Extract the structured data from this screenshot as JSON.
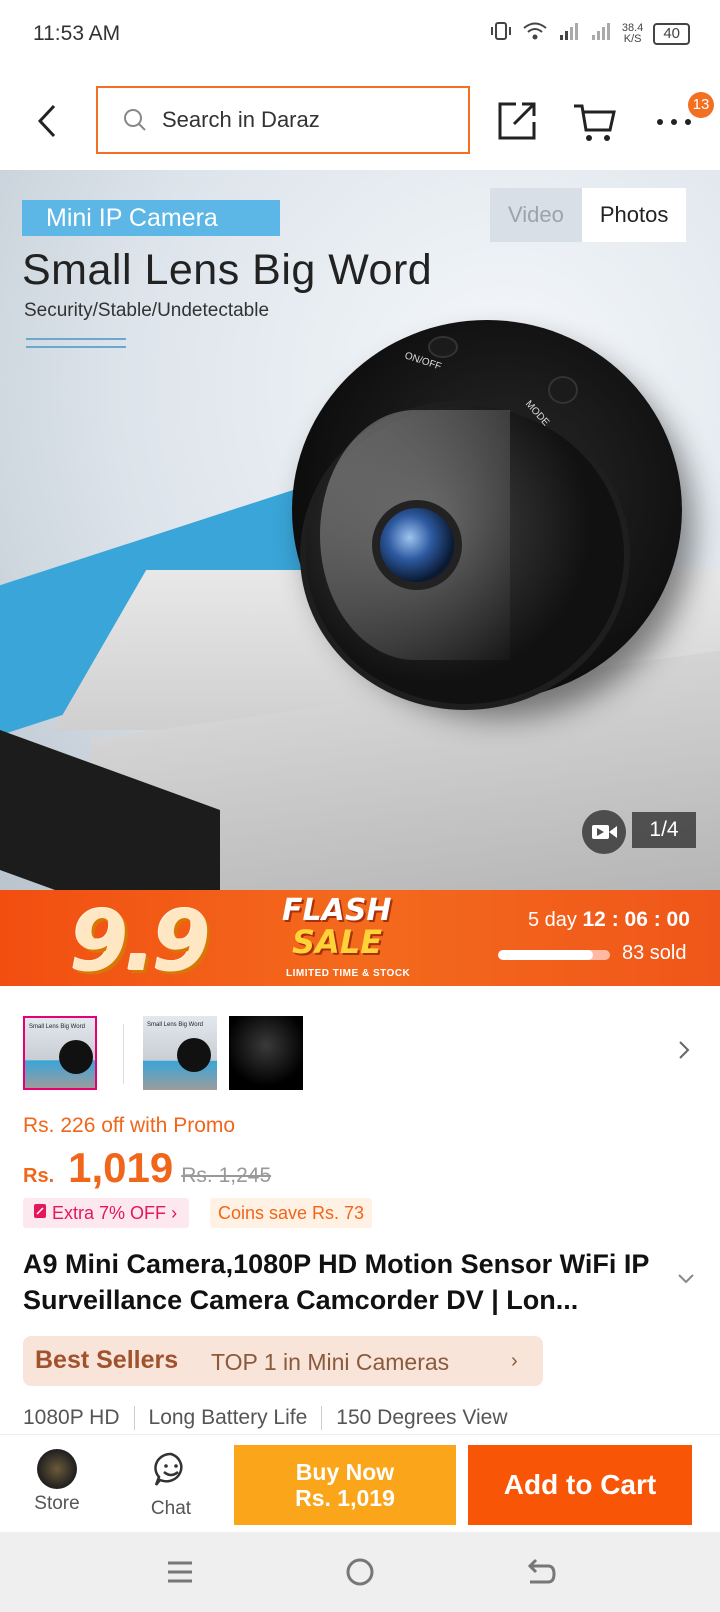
{
  "status_bar": {
    "time": "11:53 AM",
    "net_speed_value": "38.4",
    "net_speed_unit": "K/S",
    "battery": "40"
  },
  "top_bar": {
    "search_placeholder": "Search in Daraz",
    "cart_badge": "13"
  },
  "gallery": {
    "tag": "Mini IP Camera",
    "headline": "Small Lens Big Word",
    "subheadline": "Security/Stable/Undetectable",
    "camera_label_1": "ON/OFF",
    "camera_label_2": "MODE",
    "tabs": [
      "Video",
      "Photos"
    ],
    "active_tab": "Photos",
    "page_indicator": "1/4"
  },
  "flash_sale": {
    "event": "9.9",
    "word1": "FLASH",
    "word2": "SALE",
    "tagline": "LIMITED TIME & STOCK",
    "countdown_days": "5 day",
    "countdown_time": "12 : 06 : 00",
    "sold_fraction": 0.85,
    "sold_text": "83 sold"
  },
  "thumbnails": {
    "thumb_caption": "Small Lens Big Word"
  },
  "pricing": {
    "promo": "Rs. 226 off with Promo",
    "currency": "Rs.",
    "price": "1,019",
    "original_price": "Rs. 1,245",
    "extra_off": "Extra 7% OFF",
    "coins": "Coins save Rs. 73"
  },
  "product": {
    "title": "A9 Mini Camera,1080P HD Motion Sensor WiFi IP Surveillance Camera Camcorder DV | Lon...",
    "best_sellers_label": "Best Sellers",
    "best_sellers_rank": "TOP 1 in Mini Cameras",
    "features": [
      "1080P HD",
      "Long Battery Life",
      "150 Degrees View"
    ]
  },
  "actions": {
    "store": "Store",
    "chat": "Chat",
    "buy_now_line1": "Buy Now",
    "buy_now_line2": "Rs. 1,019",
    "add_to_cart": "Add to Cart"
  },
  "colors": {
    "accent": "#f36f21",
    "buy_now": "#faa51a",
    "add_to_cart": "#f85606",
    "price": "#f0661a"
  }
}
